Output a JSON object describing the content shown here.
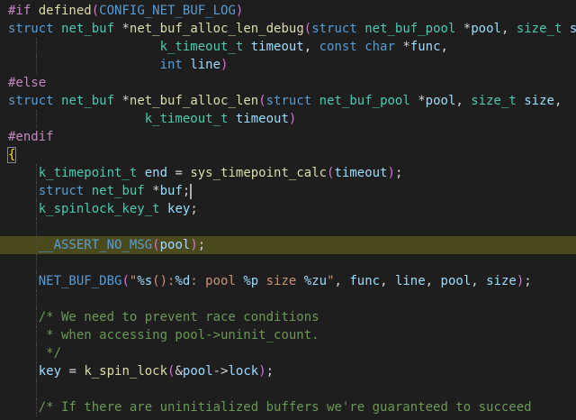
{
  "editor": {
    "language": "c",
    "lines": [
      {
        "tokens": [
          [
            "pre",
            "#if "
          ],
          [
            "fn",
            "defined"
          ],
          [
            "par1",
            "("
          ],
          [
            "mac",
            "CONFIG_NET_BUF_LOG"
          ],
          [
            "par1",
            ")"
          ]
        ]
      },
      {
        "tokens": [
          [
            "kw",
            "struct "
          ],
          [
            "type",
            "net_buf "
          ],
          [
            "pun",
            "*"
          ],
          [
            "fn",
            "net_buf_alloc_len_debug"
          ],
          [
            "par1",
            "("
          ],
          [
            "kw",
            "struct "
          ],
          [
            "type",
            "net_buf_pool "
          ],
          [
            "pun",
            "*"
          ],
          [
            "var",
            "pool"
          ],
          [
            "pun",
            ", "
          ],
          [
            "type",
            "size_t "
          ],
          [
            "var",
            "size"
          ],
          [
            "pun",
            ","
          ]
        ]
      },
      {
        "guides": [
          24
        ],
        "tokens": [
          [
            "pun",
            "                    "
          ],
          [
            "type",
            "k_timeout_t "
          ],
          [
            "var",
            "timeout"
          ],
          [
            "pun",
            ", "
          ],
          [
            "kw",
            "const "
          ],
          [
            "kw",
            "char "
          ],
          [
            "pun",
            "*"
          ],
          [
            "var",
            "func"
          ],
          [
            "pun",
            ","
          ]
        ]
      },
      {
        "guides": [
          24
        ],
        "tokens": [
          [
            "pun",
            "                    "
          ],
          [
            "kw",
            "int "
          ],
          [
            "var",
            "line"
          ],
          [
            "par1",
            ")"
          ]
        ]
      },
      {
        "tokens": [
          [
            "pre",
            "#else"
          ]
        ]
      },
      {
        "tokens": [
          [
            "kw",
            "struct "
          ],
          [
            "type",
            "net_buf "
          ],
          [
            "pun",
            "*"
          ],
          [
            "fn",
            "net_buf_alloc_len"
          ],
          [
            "par1",
            "("
          ],
          [
            "kw",
            "struct "
          ],
          [
            "type",
            "net_buf_pool "
          ],
          [
            "pun",
            "*"
          ],
          [
            "var",
            "pool"
          ],
          [
            "pun",
            ", "
          ],
          [
            "type",
            "size_t "
          ],
          [
            "var",
            "size"
          ],
          [
            "pun",
            ","
          ]
        ]
      },
      {
        "guides": [
          24
        ],
        "tokens": [
          [
            "pun",
            "                  "
          ],
          [
            "type",
            "k_timeout_t "
          ],
          [
            "var",
            "timeout"
          ],
          [
            "par1",
            ")"
          ]
        ]
      },
      {
        "tokens": [
          [
            "pre",
            "#endif"
          ]
        ]
      },
      {
        "tokens": [
          [
            "brace",
            "{"
          ]
        ]
      },
      {
        "guides": [
          24
        ],
        "tokens": [
          [
            "pun",
            "    "
          ],
          [
            "type",
            "k_timepoint_t "
          ],
          [
            "var",
            "end"
          ],
          [
            "pun",
            " = "
          ],
          [
            "fn",
            "sys_timepoint_calc"
          ],
          [
            "par1",
            "("
          ],
          [
            "var",
            "timeout"
          ],
          [
            "par1",
            ")"
          ],
          [
            "pun",
            ";"
          ]
        ]
      },
      {
        "guides": [
          24
        ],
        "tokens": [
          [
            "pun",
            "    "
          ],
          [
            "kw",
            "struct "
          ],
          [
            "type",
            "net_buf "
          ],
          [
            "pun",
            "*"
          ],
          [
            "var",
            "buf"
          ],
          [
            "pun",
            ";"
          ],
          [
            "cursor",
            ""
          ]
        ]
      },
      {
        "guides": [
          24
        ],
        "tokens": [
          [
            "pun",
            "    "
          ],
          [
            "type",
            "k_spinlock_key_t "
          ],
          [
            "var",
            "key"
          ],
          [
            "pun",
            ";"
          ]
        ]
      },
      {
        "guides": [
          24
        ],
        "tokens": []
      },
      {
        "guides": [
          24
        ],
        "highlight": true,
        "tokens": [
          [
            "pun",
            "    "
          ],
          [
            "mac",
            "__ASSERT_NO_MSG"
          ],
          [
            "par1",
            "("
          ],
          [
            "var",
            "pool"
          ],
          [
            "par1",
            ")"
          ],
          [
            "pun",
            ";"
          ]
        ]
      },
      {
        "guides": [
          24
        ],
        "tokens": []
      },
      {
        "guides": [
          24
        ],
        "tokens": [
          [
            "pun",
            "    "
          ],
          [
            "mac",
            "NET_BUF_DBG"
          ],
          [
            "par1",
            "("
          ],
          [
            "str",
            "\""
          ],
          [
            "esc",
            "%s"
          ],
          [
            "str",
            "():"
          ],
          [
            "esc",
            "%d"
          ],
          [
            "str",
            ": pool "
          ],
          [
            "esc",
            "%p"
          ],
          [
            "str",
            " size "
          ],
          [
            "esc",
            "%zu"
          ],
          [
            "str",
            "\""
          ],
          [
            "pun",
            ", "
          ],
          [
            "var",
            "func"
          ],
          [
            "pun",
            ", "
          ],
          [
            "var",
            "line"
          ],
          [
            "pun",
            ", "
          ],
          [
            "var",
            "pool"
          ],
          [
            "pun",
            ", "
          ],
          [
            "var",
            "size"
          ],
          [
            "par1",
            ")"
          ],
          [
            "pun",
            ";"
          ]
        ]
      },
      {
        "guides": [
          24
        ],
        "tokens": []
      },
      {
        "guides": [
          24
        ],
        "tokens": [
          [
            "pun",
            "    "
          ],
          [
            "cmt",
            "/* We need to prevent race conditions"
          ]
        ]
      },
      {
        "guides": [
          24
        ],
        "tokens": [
          [
            "pun",
            "    "
          ],
          [
            "cmt",
            " * when accessing pool->uninit_count."
          ]
        ]
      },
      {
        "guides": [
          24
        ],
        "tokens": [
          [
            "pun",
            "    "
          ],
          [
            "cmt",
            " */"
          ]
        ]
      },
      {
        "guides": [
          24
        ],
        "tokens": [
          [
            "pun",
            "    "
          ],
          [
            "var",
            "key"
          ],
          [
            "pun",
            " = "
          ],
          [
            "fn",
            "k_spin_lock"
          ],
          [
            "par1",
            "("
          ],
          [
            "pun",
            "&"
          ],
          [
            "var",
            "pool"
          ],
          [
            "pun",
            "->"
          ],
          [
            "var",
            "lock"
          ],
          [
            "par1",
            ")"
          ],
          [
            "pun",
            ";"
          ]
        ]
      },
      {
        "guides": [
          24
        ],
        "tokens": []
      },
      {
        "guides": [
          24
        ],
        "tokens": [
          [
            "pun",
            "    "
          ],
          [
            "cmt",
            "/* If there are uninitialized buffers we're guaranteed to succeed"
          ]
        ]
      }
    ]
  }
}
